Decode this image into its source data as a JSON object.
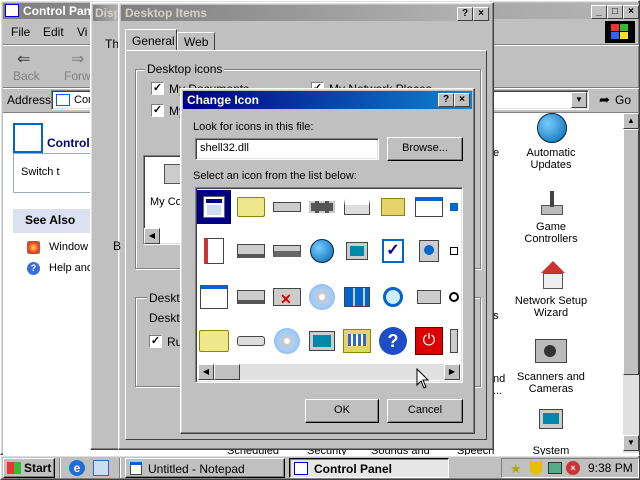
{
  "control_panel": {
    "title": "Control Panel",
    "menu": [
      "File",
      "Edit",
      "Vi"
    ],
    "toolbar": {
      "back": "Back",
      "forward": "Forwa"
    },
    "address_label": "Address",
    "address_value": "Con",
    "go_label": "Go",
    "left_title": "Control",
    "left_sub": "Switch t",
    "see_also": "See Also",
    "links": [
      "Window",
      "Help and"
    ],
    "items_right": [
      {
        "label": "Automatic Updates",
        "icon": "globe-update-icon"
      },
      {
        "label": "Game Controllers",
        "icon": "joystick-icon"
      },
      {
        "label": "Network Setup Wizard",
        "icon": "network-house-icon"
      },
      {
        "label": "Scanners and Cameras",
        "icon": "scanner-camera-icon"
      },
      {
        "label": "System",
        "icon": "computer-icon"
      }
    ],
    "partial_labels": [
      "ive",
      "ns",
      "nd",
      "..."
    ],
    "bottom_partial": [
      "Scheduled",
      "Security",
      "Sounds and",
      "Speech"
    ]
  },
  "display_window": {
    "title": "Disp",
    "tab_partial": "Th"
  },
  "desktop_items": {
    "title": "Desktop Items",
    "tabs": [
      "General",
      "Web"
    ],
    "group_title": "Desktop icons",
    "checks": [
      {
        "label": "My Documents",
        "checked": true
      },
      {
        "label": "My Network Places",
        "checked": true
      },
      {
        "label": "My",
        "checked": true
      }
    ],
    "preview_label": "My Co",
    "cleanup_group": "Deskto",
    "cleanup_label": "Deskto",
    "run_label": "Ru"
  },
  "change_icon": {
    "title": "Change Icon",
    "look_label": "Look for icons in this file:",
    "file_value": "shell32.dll",
    "browse_label": "Browse...",
    "select_label": "Select an icon from the list below:",
    "ok_label": "OK",
    "cancel_label": "Cancel",
    "icons": [
      [
        "window-app-icon",
        "folder-open-icon",
        "drive-icon",
        "chip-icon",
        "printer-icon",
        "network-folder-icon",
        "window-list-icon"
      ],
      [
        "document-icon",
        "network-drive-icon",
        "network-drive-2-icon",
        "globe-icon",
        "computer-network-icon",
        "check-window-icon",
        "speaker-window-icon"
      ],
      [
        "blank-window-icon",
        "drive-shared-icon",
        "drive-disconnect-icon",
        "cd-drive-icon",
        "network-tree-icon",
        "magnifier-icon",
        "drive-arrow-icon"
      ],
      [
        "folder-icon",
        "floppy-icon",
        "cd-icon",
        "computers-icon",
        "calendar-folder-icon",
        "help-icon",
        "power-icon"
      ]
    ]
  },
  "taskbar": {
    "start": "Start",
    "tasks": [
      {
        "label": "Untitled - Notepad",
        "active": false
      },
      {
        "label": "Control Panel",
        "active": true
      }
    ],
    "clock": "9:38 PM"
  },
  "colors": {
    "title_active": "#000080",
    "title_inactive": "#808080",
    "face": "#c0c0c0",
    "desktop": "#008080",
    "see_also_band": "#dbe1f0"
  }
}
